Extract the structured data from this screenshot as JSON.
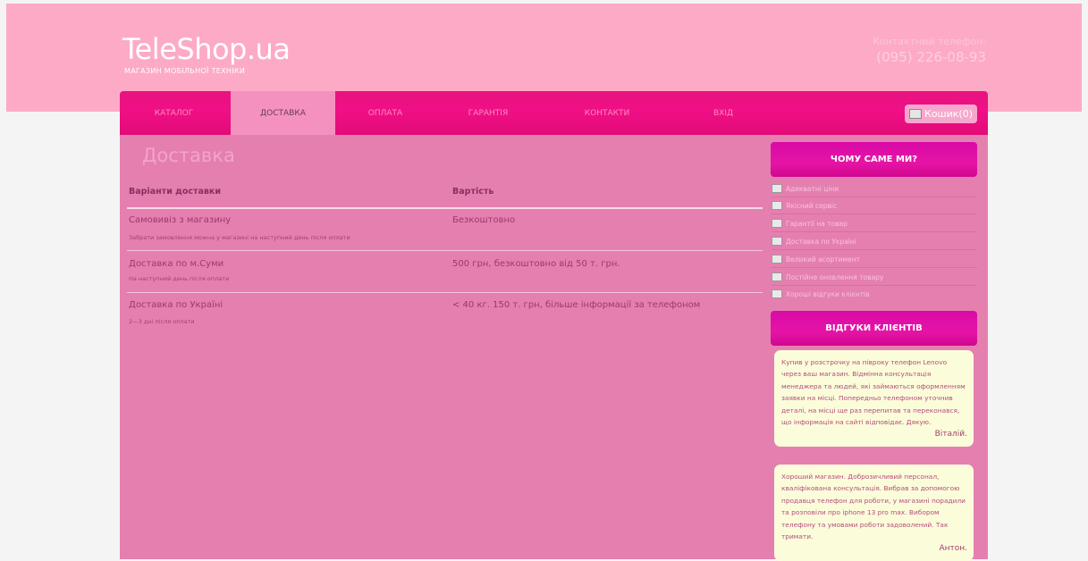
{
  "header": {
    "logo": "TeleShop.ua",
    "tagline": "МАГАЗИН МОБІЛЬНОЇ ТЕХНІКИ",
    "phone_label": "Контактний телефон:",
    "phone_number": "(095) 226-08-93"
  },
  "nav": {
    "items": [
      {
        "label": "Каталог"
      },
      {
        "label": "Доставка",
        "active": true
      },
      {
        "label": "Оплата"
      },
      {
        "label": "Гарантія"
      },
      {
        "label": "Контакти"
      },
      {
        "label": "Вхід"
      }
    ],
    "cart_label": "Кошик(0)"
  },
  "main": {
    "title": "Доставка",
    "columns": [
      "Варіанти доставки",
      "Вартість"
    ],
    "rows": [
      {
        "title": "Самовивіз з магазину",
        "subtitle": "Забрати замовлення можна у магазині на наступний день після оплати",
        "price": "Безкоштовно"
      },
      {
        "title": "Доставка по м.Суми",
        "subtitle": "На наступний день після оплати",
        "price": "500 грн, безкоштовно від 50 т. грн."
      },
      {
        "title": "Доставка по Україні",
        "subtitle": "2—3 дні після оплати",
        "price": "< 40 кг. 150 т. грн, більше інформації за телефоном"
      }
    ]
  },
  "sidebar": {
    "why_title": "Чому саме ми?",
    "benefits": [
      "Адекватні ціни",
      "Якісний сервіс",
      "Гарантії на товар",
      "Доставка по Україні",
      "Великий асортимент",
      "Постійне оновлення товару",
      "Хороші відгуки клієнтів"
    ],
    "reviews_title": "Відгуки клієнтів",
    "reviews": [
      {
        "text": "Купив у розстрочку на півроку телефон Lenovo через ваш магазин. Відмінна консультація менеджера та людей, які займаються оформленням заявки на місці. Попередньо телефоном уточнив деталі, на місці ще раз перепитав та переконався, що інформація на сайті відповідає. Дякую.",
        "author": "Віталій."
      },
      {
        "text": "Хороший магазин. Доброзичливий персонал, кваліфікована консультація. Вибрав за допомогою продавця телефон для роботи, у магазині порадили та розповіли про iphone 13 pro max. Вибором телефону та умовами роботи задоволений. Так тримати.",
        "author": "Антон."
      }
    ]
  }
}
